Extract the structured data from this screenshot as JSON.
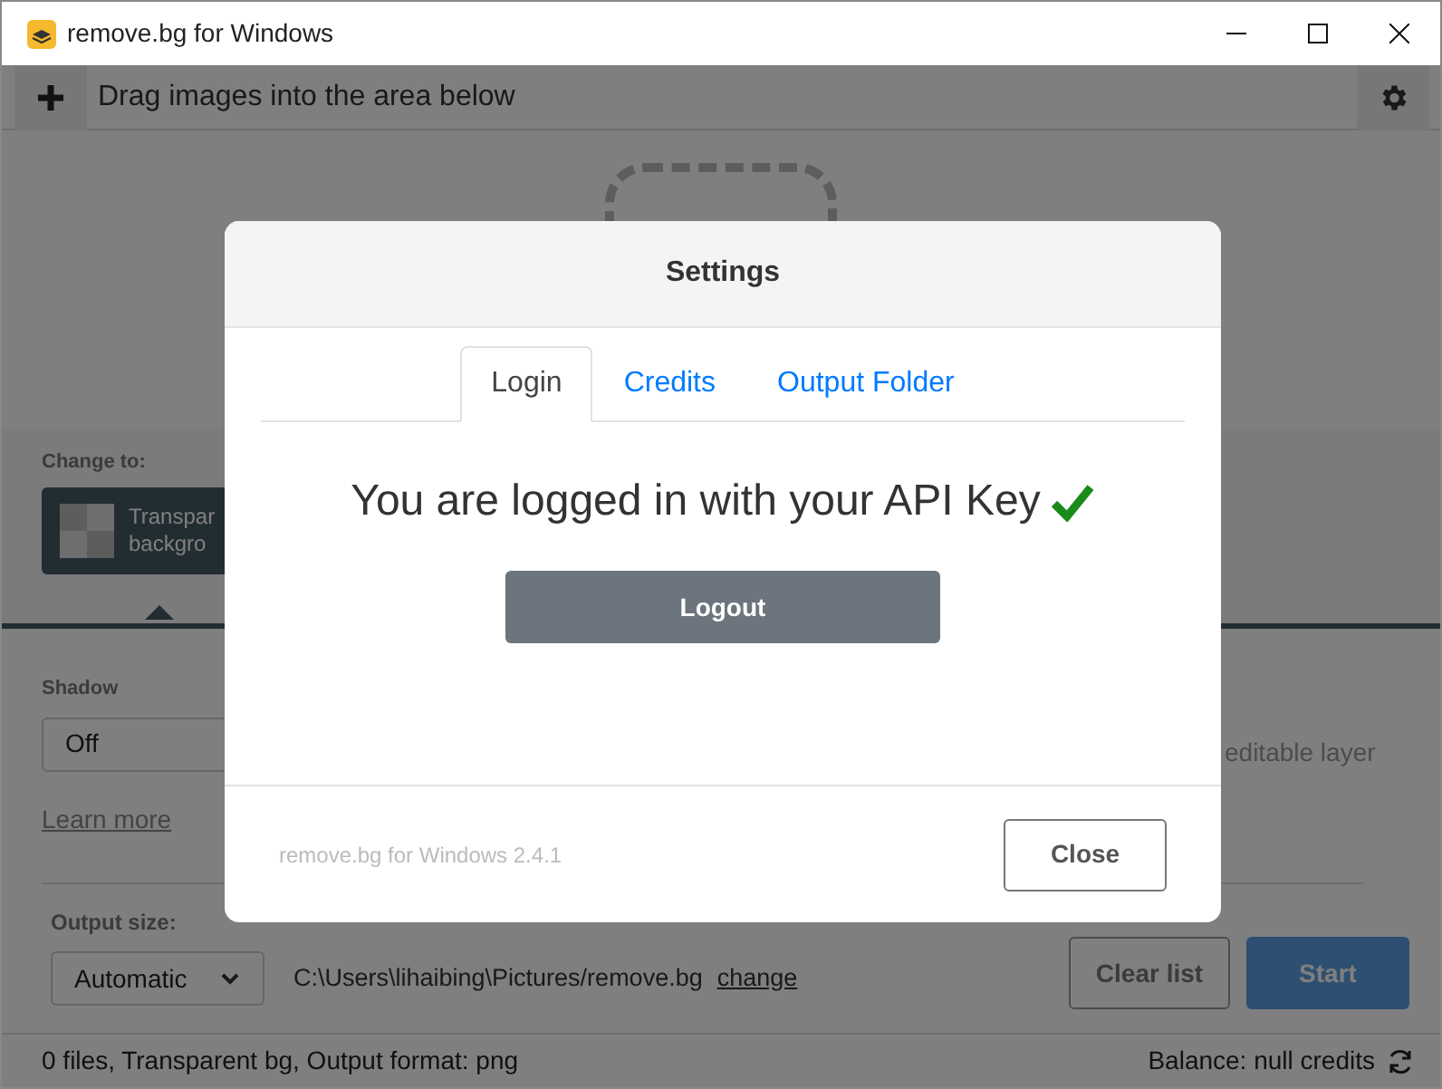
{
  "window": {
    "title": "remove.bg for Windows"
  },
  "toolbar": {
    "hint": "Drag images into the area below"
  },
  "background_panel": {
    "label": "Change to:",
    "option": {
      "label_lines": [
        "Transpar",
        "backgro"
      ],
      "selected": true
    }
  },
  "shadow": {
    "label": "Shadow",
    "value": "Off",
    "learn_more": "Learn more",
    "note": "editable layer"
  },
  "output": {
    "size_label": "Output size:",
    "size_value": "Automatic",
    "folder_path": "C:\\Users\\lihaibing\\Pictures/remove.bg",
    "change_link": "change"
  },
  "actions": [
    {
      "label": "Clear list",
      "kind": "secondary"
    },
    {
      "label": "Start",
      "kind": "primary"
    }
  ],
  "status_bar": {
    "summary": "0 files, Transparent bg, Output format: png",
    "balance": "Balance: null credits"
  },
  "dialog": {
    "title": "Settings",
    "tabs": [
      {
        "label": "Login",
        "selected": true
      },
      {
        "label": "Credits",
        "selected": false
      },
      {
        "label": "Output Folder",
        "selected": false
      }
    ],
    "message": "You are logged in with your API Key",
    "logged_in": true,
    "logout": "Logout",
    "version": "remove.bg for Windows 2.4.1",
    "close": "Close"
  }
}
